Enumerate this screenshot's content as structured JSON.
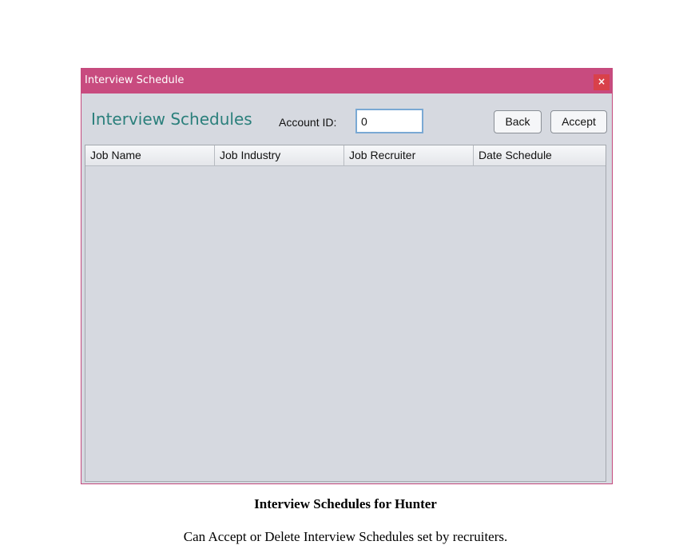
{
  "window": {
    "title": "Interview Schedule",
    "close_label": "×"
  },
  "header": {
    "heading": "Interview Schedules",
    "account_label": "Account ID:",
    "account_value": "0",
    "back_label": "Back",
    "accept_label": "Accept"
  },
  "table": {
    "columns": [
      "Job Name",
      "Job Industry",
      "Job Recruiter",
      "Date Schedule"
    ],
    "rows": []
  },
  "document": {
    "caption": "Interview Schedules for Hunter",
    "description": "Can Accept or Delete Interview Schedules set by recruiters."
  },
  "colors": {
    "titlebar": "#c84b7f",
    "heading": "#2a7f7b",
    "close_button": "#d8414a",
    "window_bg": "#d6d9e0"
  }
}
